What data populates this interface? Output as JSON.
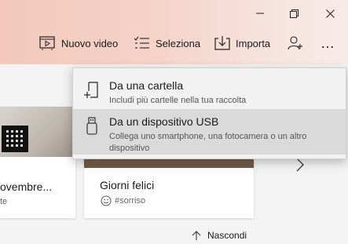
{
  "window": {
    "minimize_icon": "minimize-icon",
    "restore_icon": "restore-icon",
    "close_icon": "close-icon"
  },
  "toolbar": {
    "new_video": "Nuovo video",
    "select": "Seleziona",
    "import": "Importa",
    "add_person_icon": "add-person-icon",
    "more_icon": "more-icon",
    "more_label": "…"
  },
  "cards": [
    {
      "title": "ovembre...",
      "subtitle": "te"
    },
    {
      "title": "Giorni felici",
      "subtitle": "#sorriso"
    }
  ],
  "hide": {
    "label": "Nascondi"
  },
  "import_menu": {
    "items": [
      {
        "title": "Da una cartella",
        "description": "Includi più cartelle nella tua raccolta",
        "icon": "folder-add-icon",
        "highlighted": false
      },
      {
        "title": "Da un dispositivo USB",
        "description": "Collega uno smartphone, una fotocamera o un altro dispositivo",
        "icon": "usb-icon",
        "highlighted": true
      }
    ]
  },
  "colors": {
    "header_gradient_start": "#f2c9bb",
    "header_gradient_end": "#f7ebe8",
    "menu_background": "#f2f2f2",
    "menu_highlight": "#dadada"
  }
}
